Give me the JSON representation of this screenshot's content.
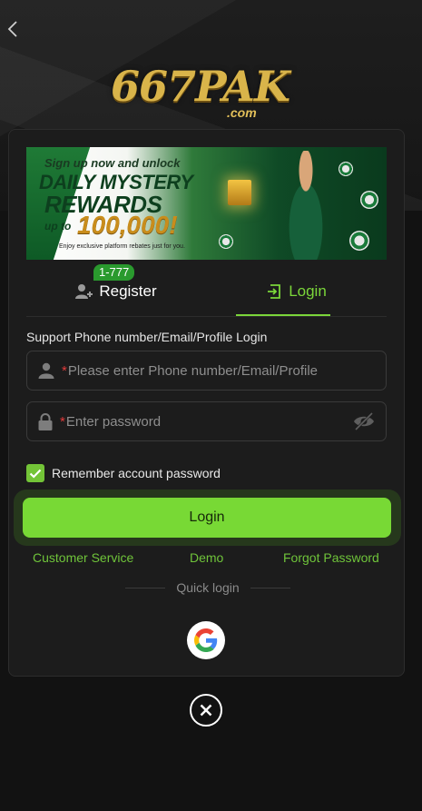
{
  "header": {
    "logo_text": "667PAK",
    "logo_sub": ".com"
  },
  "banner": {
    "line1": "Sign up now and unlock",
    "line2": "DAILY MYSTERY",
    "line3": "REWARDS",
    "line4": "up to",
    "amount": "100,000!",
    "footnote": "Enjoy exclusive platform rebates just for you."
  },
  "tabs": {
    "register_label": "Register",
    "register_badge": "1-777",
    "login_label": "Login",
    "active": "login"
  },
  "form": {
    "title": "Support Phone number/Email/Profile Login",
    "account_placeholder": "Please enter Phone number/Email/Profile",
    "password_placeholder": "Enter password",
    "required_mark": "*",
    "remember_label": "Remember account password",
    "remember_checked": true,
    "login_button": "Login"
  },
  "links": {
    "customer_service": "Customer Service",
    "demo": "Demo",
    "forgot_password": "Forgot Password"
  },
  "quick_login": {
    "label": "Quick login",
    "providers": [
      "google-icon"
    ]
  },
  "colors": {
    "accent": "#78d935",
    "link": "#6fc43a",
    "required": "#e23b3b",
    "background": "#121212",
    "card": "#1c1c1c"
  }
}
